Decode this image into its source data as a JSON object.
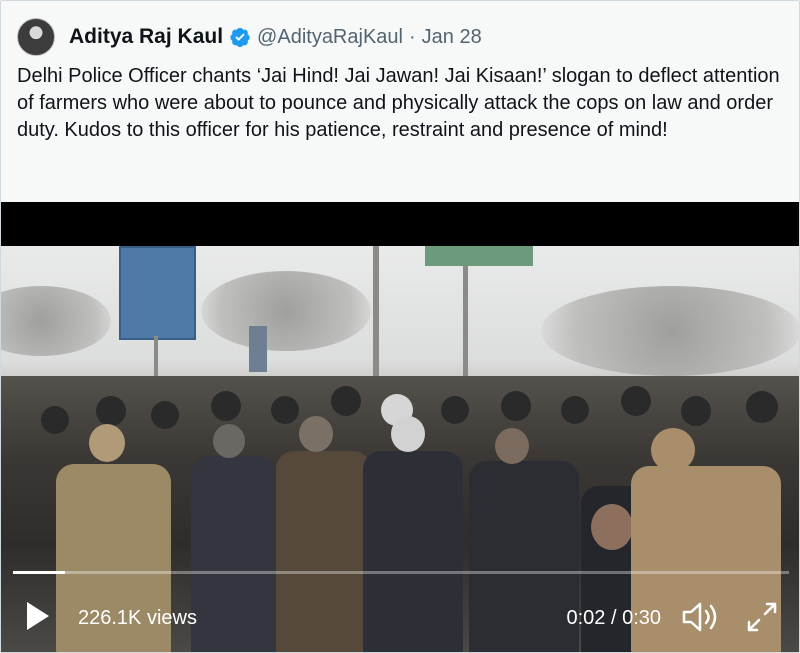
{
  "tweet": {
    "author_name": "Aditya Raj Kaul",
    "handle": "@AdityaRajKaul",
    "separator": "·",
    "date": "Jan 28",
    "text": "Delhi Police Officer chants ‘Jai Hind! Jai Jawan! Jai Kisaan!’ slogan to deflect attention of farmers who were about to pounce and physically attack the cops on law and order duty. Kudos to this officer for his patience, restraint and presence of mind!",
    "verified_color": "#1d9bf0"
  },
  "video": {
    "views": "226.1K views",
    "time": "0:02 / 0:30",
    "progress_fraction": 0.067,
    "icons": {
      "play": "play-icon",
      "volume": "volume-icon",
      "fullscreen": "fullscreen-icon"
    }
  }
}
